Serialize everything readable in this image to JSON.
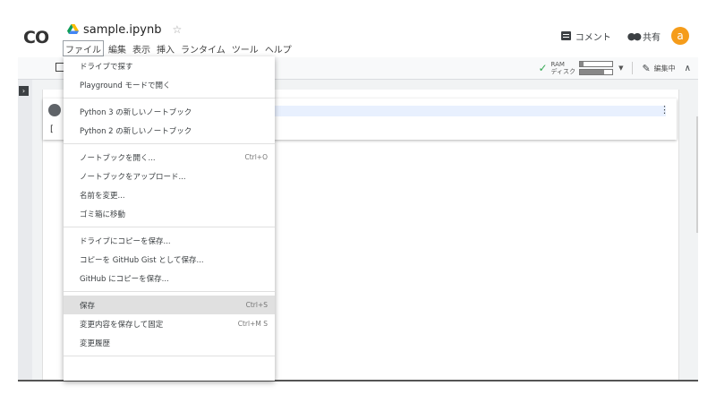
{
  "header": {
    "logo": "CO",
    "file_title": "sample.ipynb",
    "star": "☆",
    "menus": [
      "ファイル",
      "編集",
      "表示",
      "挿入",
      "ランタイム",
      "ツール",
      "ヘルプ"
    ],
    "comment_label": "コメント",
    "share_label": "共有",
    "avatar_letter": "a"
  },
  "toolbar": {
    "check": "✓",
    "ram_label": "RAM",
    "disk_label": "ディスク",
    "ram_usage": 0.1,
    "disk_usage": 0.75,
    "edit_label": "編集中"
  },
  "notebook": {
    "cell_output_char": "[",
    "cell_menu": "⋮"
  },
  "file_menu": {
    "groups": [
      [
        {
          "label": "ドライブで探す",
          "shortcut": ""
        },
        {
          "label": "Playground モードで開く",
          "shortcut": ""
        }
      ],
      [
        {
          "label": "Python 3 の新しいノートブック",
          "shortcut": ""
        },
        {
          "label": "Python 2 の新しいノートブック",
          "shortcut": ""
        }
      ],
      [
        {
          "label": "ノートブックを開く...",
          "shortcut": "Ctrl+O"
        },
        {
          "label": "ノートブックをアップロード...",
          "shortcut": ""
        },
        {
          "label": "名前を変更...",
          "shortcut": ""
        },
        {
          "label": "ゴミ箱に移動",
          "shortcut": ""
        }
      ],
      [
        {
          "label": "ドライブにコピーを保存...",
          "shortcut": ""
        },
        {
          "label": "コピーを GitHub Gist として保存...",
          "shortcut": ""
        },
        {
          "label": "GitHub にコピーを保存...",
          "shortcut": ""
        }
      ],
      [
        {
          "label": "保存",
          "shortcut": "Ctrl+S"
        },
        {
          "label": "変更内容を保存して固定",
          "shortcut": "Ctrl+M S"
        },
        {
          "label": "変更履歴",
          "shortcut": ""
        }
      ]
    ]
  },
  "colors": {
    "accent_avatar": "#f59c1a",
    "check_green": "#34a853",
    "drive_yellow": "#fbbc04",
    "drive_blue": "#4285f4",
    "drive_green": "#0f9d58"
  }
}
